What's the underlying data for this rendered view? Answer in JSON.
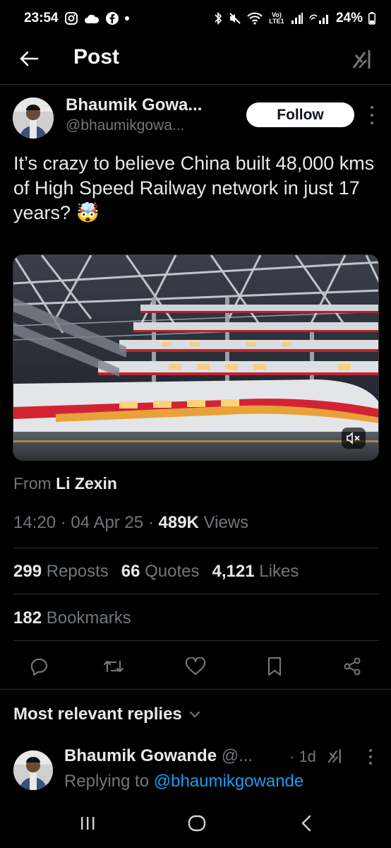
{
  "status_bar": {
    "time": "23:54",
    "battery": "24%",
    "icons": [
      "instagram-icon",
      "cloud-icon",
      "facebook-icon",
      "notification-dot",
      "bluetooth-icon",
      "mute-icon",
      "wifi-icon",
      "volte-icon",
      "signal-icon",
      "signal-2-icon",
      "battery-icon"
    ],
    "volte_label": "Vo) LTE1"
  },
  "header": {
    "title": "Post",
    "back_icon": "arrow-left-icon",
    "grok_icon": "grok-icon"
  },
  "post": {
    "author_name": "Bhaumik Gowa...",
    "author_handle": "@bhaumikgowa...",
    "follow_label": "Follow",
    "text": "It’s crazy to believe China built 48,000 kms of High Speed Railway network in just 17 years? 🤯",
    "media_type": "video",
    "from_prefix": "From",
    "from_name": "Li Zexin",
    "time": "14:20",
    "date": "04 Apr 25",
    "views_count": "489K",
    "views_label": "Views",
    "reposts_count": "299",
    "reposts_label": "Reposts",
    "quotes_count": "66",
    "quotes_label": "Quotes",
    "likes_count": "4,121",
    "likes_label": "Likes",
    "bookmarks_count": "182",
    "bookmarks_label": "Bookmarks",
    "separator": "·"
  },
  "actions": [
    "reply-icon",
    "repost-icon",
    "like-icon",
    "bookmark-icon",
    "share-icon"
  ],
  "replies": {
    "header": "Most relevant replies",
    "items": [
      {
        "name": "Bhaumik Gowande",
        "handle_trunc": "@...",
        "time": "· 1d",
        "replying_prefix": "Replying to",
        "replying_to": "@bhaumikgowande"
      }
    ]
  },
  "colors": {
    "background": "#000000",
    "text": "#e7e9ea",
    "secondary": "#71767b",
    "accent": "#1d9bf0",
    "divider": "#2f3336"
  }
}
